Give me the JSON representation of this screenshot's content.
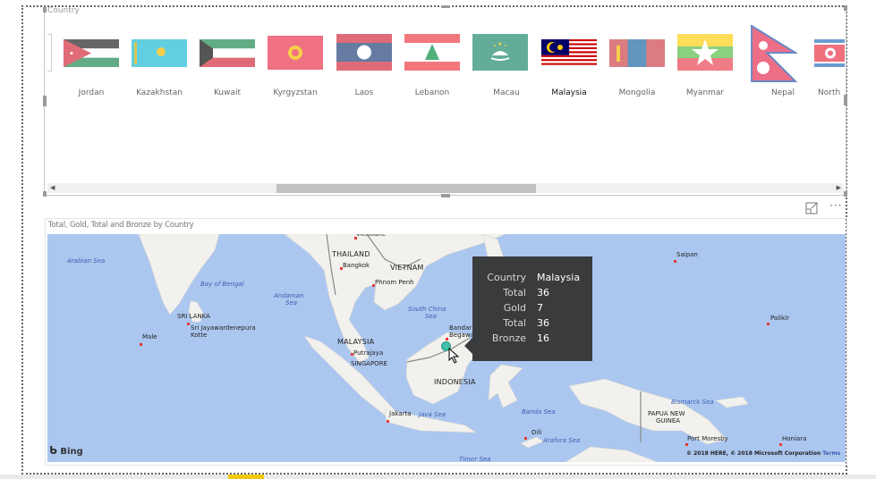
{
  "slicer": {
    "title": "Country",
    "selected": "Malaysia",
    "items": [
      {
        "label": "Jordan",
        "flag": "jordan-flag"
      },
      {
        "label": "Kazakhstan",
        "flag": "kazakhstan-flag"
      },
      {
        "label": "Kuwait",
        "flag": "kuwait-flag"
      },
      {
        "label": "Kyrgyzstan",
        "flag": "kyrgyzstan-flag"
      },
      {
        "label": "Laos",
        "flag": "laos-flag"
      },
      {
        "label": "Lebanon",
        "flag": "lebanon-flag"
      },
      {
        "label": "Macau",
        "flag": "macau-flag"
      },
      {
        "label": "Malaysia",
        "flag": "malaysia-flag"
      },
      {
        "label": "Mongolia",
        "flag": "mongolia-flag"
      },
      {
        "label": "Myanmar",
        "flag": "myanmar-flag"
      },
      {
        "label": "Nepal",
        "flag": "nepal-flag"
      },
      {
        "label": "North",
        "flag": "north-korea-flag"
      }
    ]
  },
  "visual_header": {
    "focus_icon": "focus-mode-icon",
    "more_label": "···"
  },
  "map": {
    "title": "Total, Gold, Total and Bronze by Country",
    "labels": {
      "vientiane": "Vientiane",
      "thailand": "THAILAND",
      "bangkok": "Bangkok",
      "vietnam": "VIETNAM",
      "phnom_penh": "Phnom Penh",
      "arabian_sea": "Arabian Sea",
      "bay_of_bengal": "Bay of Bengal",
      "andaman_sea_1": "Andaman",
      "andaman_sea_2": "Sea",
      "south_china_sea_1": "South China",
      "south_china_sea_2": "Sea",
      "sri_lanka": "SRI LANKA",
      "sri_jaya": "Sri Jayawardenepura",
      "kotte": "Kotte",
      "male": "Male",
      "malaysia": "MALAYSIA",
      "putrajaya": "Putrajaya",
      "singapore": "SINGAPORE",
      "bandar_1": "Bandar Seri",
      "bandar_2": "Begawan",
      "indonesia": "INDONESIA",
      "jakarta": "Jakarta",
      "java_sea": "Java Sea",
      "banda_sea": "Banda Sea",
      "dili": "Dili",
      "arafura_sea": "Arafura Sea",
      "timor_sea": "Timor Sea",
      "bismarck_sea": "Bismarck Sea",
      "png_1": "PAPUA NEW",
      "png_2": "GUINEA",
      "port_moresby": "Port Moresby",
      "honiara": "Honiara",
      "saipan": "Saipan",
      "palikir": "Palikir"
    },
    "bing": "Bing",
    "copyright": "© 2018 HERE, © 2018 Microsoft Corporation",
    "terms": "Terms",
    "colors": {
      "water": "#abc7f0",
      "land": "#f2f1ee",
      "marker": "#3fbfa8"
    }
  },
  "tooltip": {
    "rows": [
      {
        "key": "Country",
        "value": "Malaysia"
      },
      {
        "key": "Total",
        "value": "36"
      },
      {
        "key": "Gold",
        "value": "7"
      },
      {
        "key": "Total",
        "value": "36"
      },
      {
        "key": "Bronze",
        "value": "16"
      }
    ]
  }
}
